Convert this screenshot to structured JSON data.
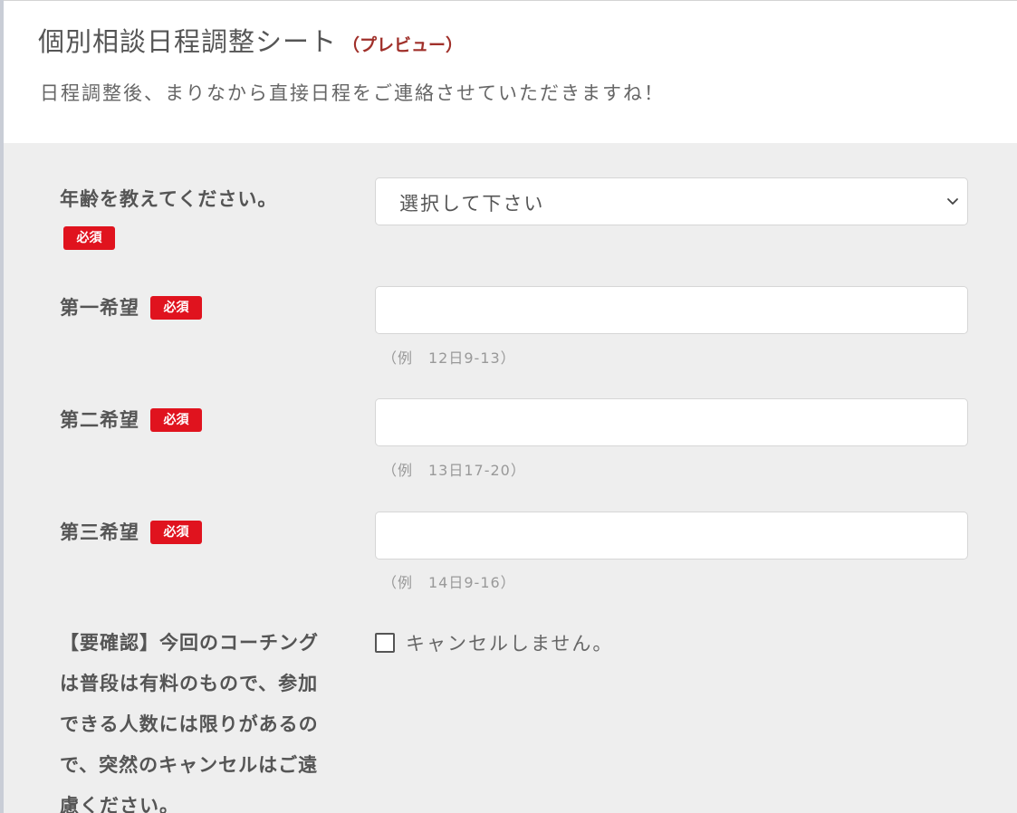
{
  "header": {
    "title": "個別相談日程調整シート",
    "preview_tag": "（プレビュー）",
    "subtitle": "日程調整後、まりなから直接日程をご連絡させていただきますね！"
  },
  "required_label": "必須",
  "form": {
    "age": {
      "label": "年齢を教えてください。",
      "select_value": "選択して下さい"
    },
    "first_choice": {
      "label": "第一希望",
      "value": "",
      "hint": "（例　12日9-13）"
    },
    "second_choice": {
      "label": "第二希望",
      "value": "",
      "hint": "（例　13日17-20）"
    },
    "third_choice": {
      "label": "第三希望",
      "value": "",
      "hint": "（例　14日9-16）"
    },
    "confirm": {
      "label": "【要確認】今回のコーチングは普段は有料のもので、参加できる人数には限りがあるので、突然のキャンセルはご遠慮ください。",
      "checkbox_label": "キャンセルしません。"
    }
  },
  "colors": {
    "required_badge": "#e0131e",
    "preview_tag": "#a0302a",
    "form_background": "#eeeeee",
    "text": "#555555"
  },
  "icons": {
    "select_arrow": "chevron-down-icon"
  }
}
